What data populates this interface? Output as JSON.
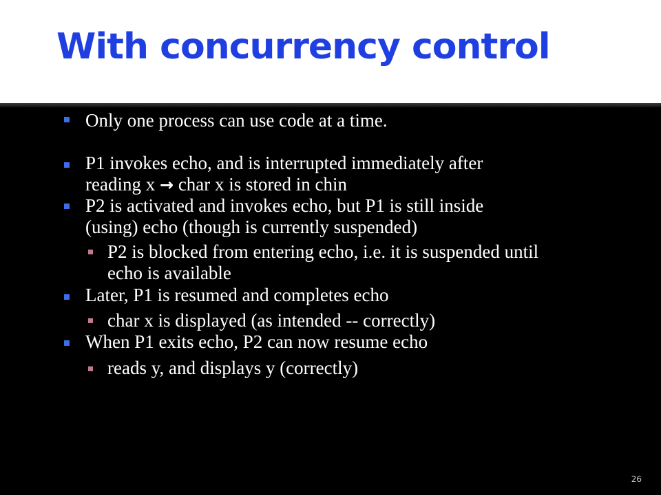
{
  "title": "With concurrency control",
  "bullets": [
    {
      "line1": "Only one process can use code at a time."
    },
    {
      "line1": "P1 invokes echo, and is interrupted immediately after",
      "line2_a": "reading x ",
      "arrow": "→",
      "line2_b": " char x is stored in chin"
    },
    {
      "line1": "P2 is activated and invokes echo, but P1 is still inside",
      "line2": "(using) echo (though is currently suspended)"
    },
    {
      "sub": true,
      "line1": "P2 is blocked from entering echo, i.e. it is suspended until",
      "line2": "echo is available"
    },
    {
      "line1": "Later, P1 is resumed and completes echo"
    },
    {
      "sub": true,
      "line1": "char x is displayed (as intended -- correctly)"
    },
    {
      "line1": "When P1 exits echo, P2 can now resume echo"
    },
    {
      "sub": true,
      "line1": "reads y, and displays y (correctly)"
    }
  ],
  "slide_number": "26",
  "colors": {
    "title": "#1f3fe0",
    "bullet": "#3b6ee8",
    "sub_bullet": "#c07a8a"
  }
}
